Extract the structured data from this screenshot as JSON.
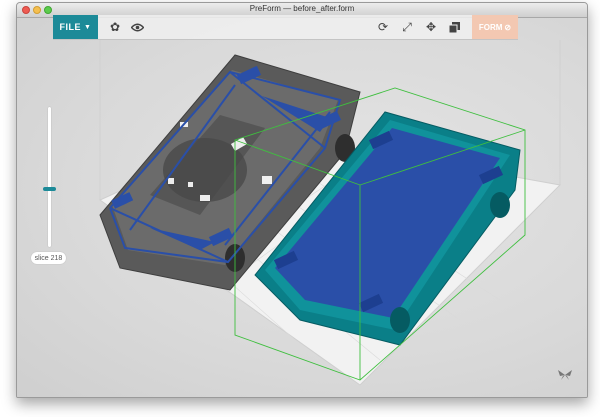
{
  "window": {
    "title": "PreForm — before_after.form"
  },
  "toolbar": {
    "file_label": "FILE",
    "form_label": "FORM",
    "icons": [
      "settings-gear-icon",
      "eye-icon",
      "rotate-icon",
      "scale-icon",
      "move-icon",
      "layout-icon",
      "supports-icon"
    ]
  },
  "slider": {
    "label": "slice 218",
    "level": 0.57
  },
  "colors": {
    "accent": "#1c8a98",
    "form_button": "#f3c8b2",
    "model_gray": "#5a5a5a",
    "model_teal": "#0a8a92",
    "supports_blue": "#2a4fa8"
  }
}
